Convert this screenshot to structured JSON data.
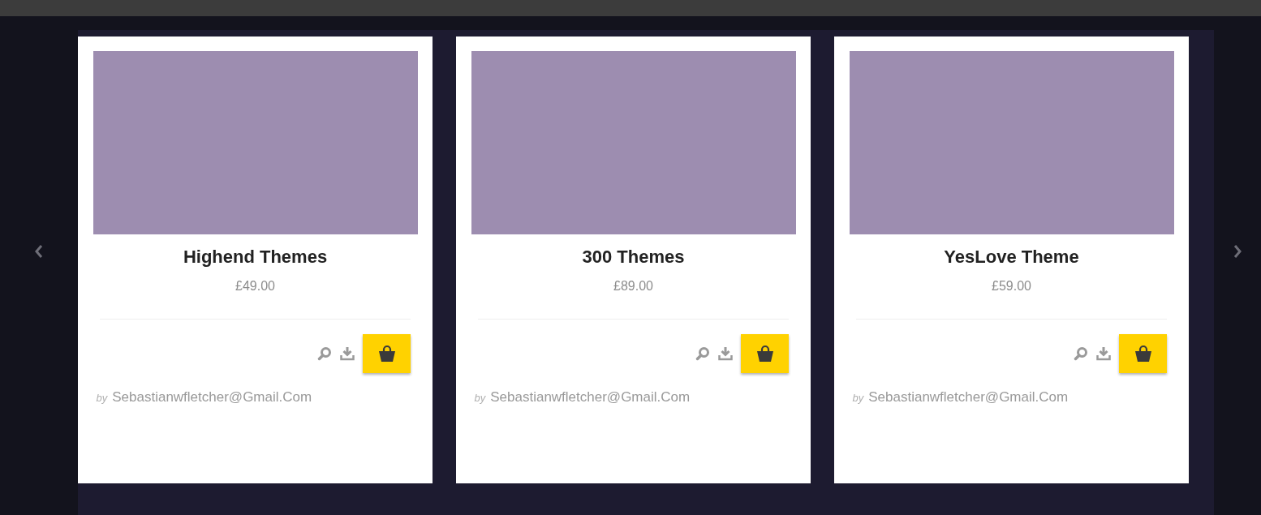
{
  "products": [
    {
      "title": "Highend Themes",
      "price": "£49.00",
      "by": "by",
      "author": "Sebastianwfletcher@Gmail.Com"
    },
    {
      "title": "300 Themes",
      "price": "£89.00",
      "by": "by",
      "author": "Sebastianwfletcher@Gmail.Com"
    },
    {
      "title": "YesLove Theme",
      "price": "£59.00",
      "by": "by",
      "author": "Sebastianwfletcher@Gmail.Com"
    }
  ]
}
